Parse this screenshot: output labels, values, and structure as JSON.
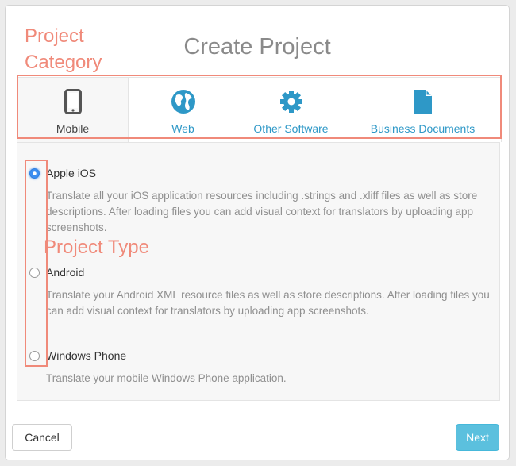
{
  "dialog": {
    "title": "Create Project",
    "annotations": {
      "category_label": "Project Category",
      "type_label": "Project Type",
      "highlight_color": "#f08a7a"
    }
  },
  "categories": [
    {
      "label": "Mobile",
      "icon": "mobile-phone-icon",
      "active": true
    },
    {
      "label": "Web",
      "icon": "globe-icon",
      "active": false
    },
    {
      "label": "Other Software",
      "icon": "gear-icon",
      "active": false
    },
    {
      "label": "Business Documents",
      "icon": "document-icon",
      "active": false
    }
  ],
  "project_types": [
    {
      "label": "Apple iOS",
      "selected": true,
      "description": "Translate all your iOS application resources including .strings and .xliff files as well as store descriptions. After loading files you can add visual context for translators by uploading app screenshots."
    },
    {
      "label": "Android",
      "selected": false,
      "description": "Translate your Android XML resource files as well as store descriptions. After loading files you can add visual context for translators by uploading app screenshots."
    },
    {
      "label": "Windows Phone",
      "selected": false,
      "description": "Translate your mobile Windows Phone application."
    }
  ],
  "footer": {
    "cancel_label": "Cancel",
    "next_label": "Next"
  },
  "colors": {
    "link": "#2e98c7",
    "primary_button": "#5bc0de",
    "radio_selected": "#3d8ef0"
  }
}
